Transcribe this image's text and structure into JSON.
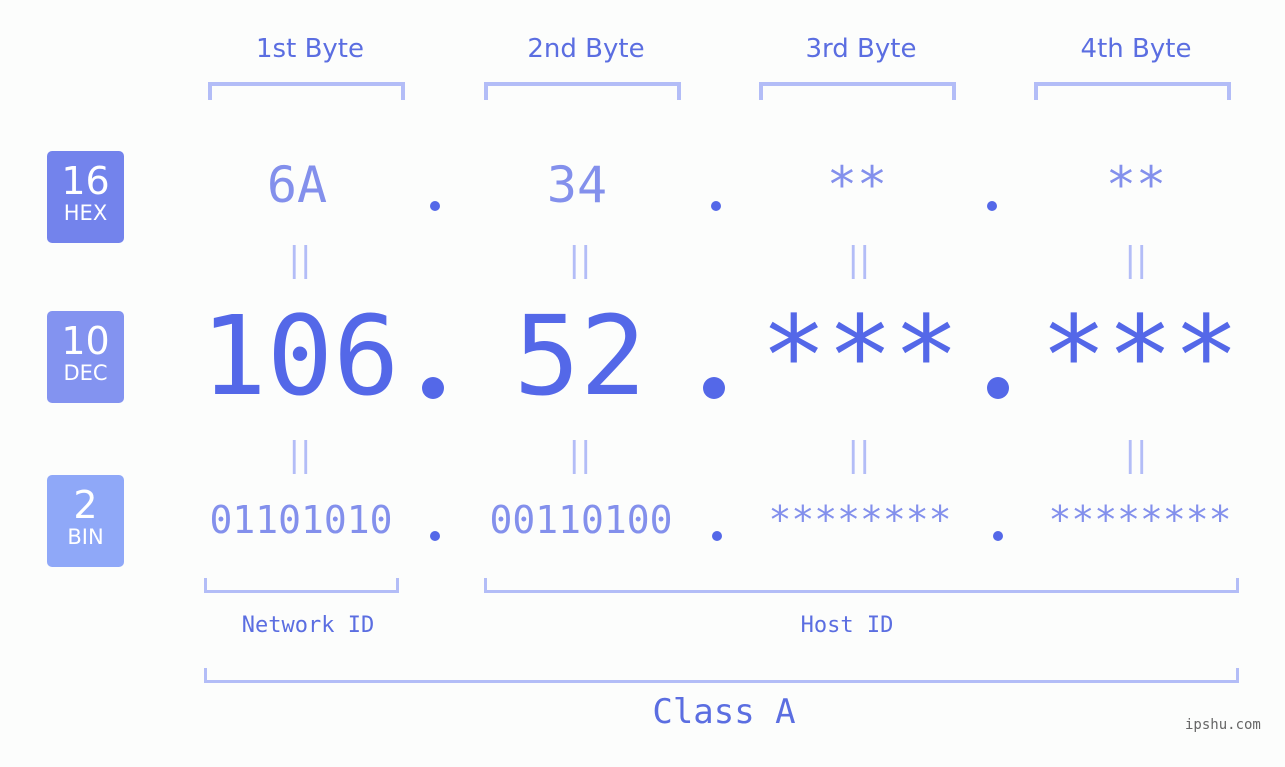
{
  "headers": [
    "1st Byte",
    "2nd Byte",
    "3rd Byte",
    "4th Byte"
  ],
  "badges": {
    "hex": {
      "num": "16",
      "label": "HEX",
      "color": "#7383ec"
    },
    "dec": {
      "num": "10",
      "label": "DEC",
      "color": "#8393f0"
    },
    "bin": {
      "num": "2",
      "label": "BIN",
      "color": "#8fa8f8"
    }
  },
  "hex": [
    "6A",
    "34",
    "**",
    "**"
  ],
  "dec": [
    "106",
    "52",
    "***",
    "***"
  ],
  "bin": [
    "01101010",
    "00110100",
    "********",
    "********"
  ],
  "equals": "=",
  "network_label": "Network ID",
  "host_label": "Host ID",
  "class_label": "Class A",
  "watermark": "ipshu.com"
}
